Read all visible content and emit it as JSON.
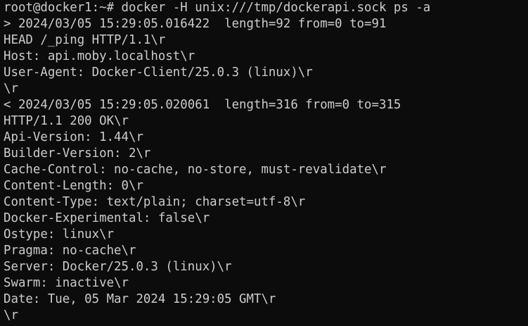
{
  "terminal": {
    "prompt": "root@docker1:~# ",
    "command": "docker -H unix:///tmp/dockerapi.sock ps -a",
    "lines": [
      "> 2024/03/05 15:29:05.016422  length=92 from=0 to=91",
      "HEAD /_ping HTTP/1.1\\r",
      "Host: api.moby.localhost\\r",
      "User-Agent: Docker-Client/25.0.3 (linux)\\r",
      "\\r",
      "< 2024/03/05 15:29:05.020061  length=316 from=0 to=315",
      "HTTP/1.1 200 OK\\r",
      "Api-Version: 1.44\\r",
      "Builder-Version: 2\\r",
      "Cache-Control: no-cache, no-store, must-revalidate\\r",
      "Content-Length: 0\\r",
      "Content-Type: text/plain; charset=utf-8\\r",
      "Docker-Experimental: false\\r",
      "Ostype: linux\\r",
      "Pragma: no-cache\\r",
      "Server: Docker/25.0.3 (linux)\\r",
      "Swarm: inactive\\r",
      "Date: Tue, 05 Mar 2024 15:29:05 GMT\\r",
      "\\r"
    ]
  }
}
